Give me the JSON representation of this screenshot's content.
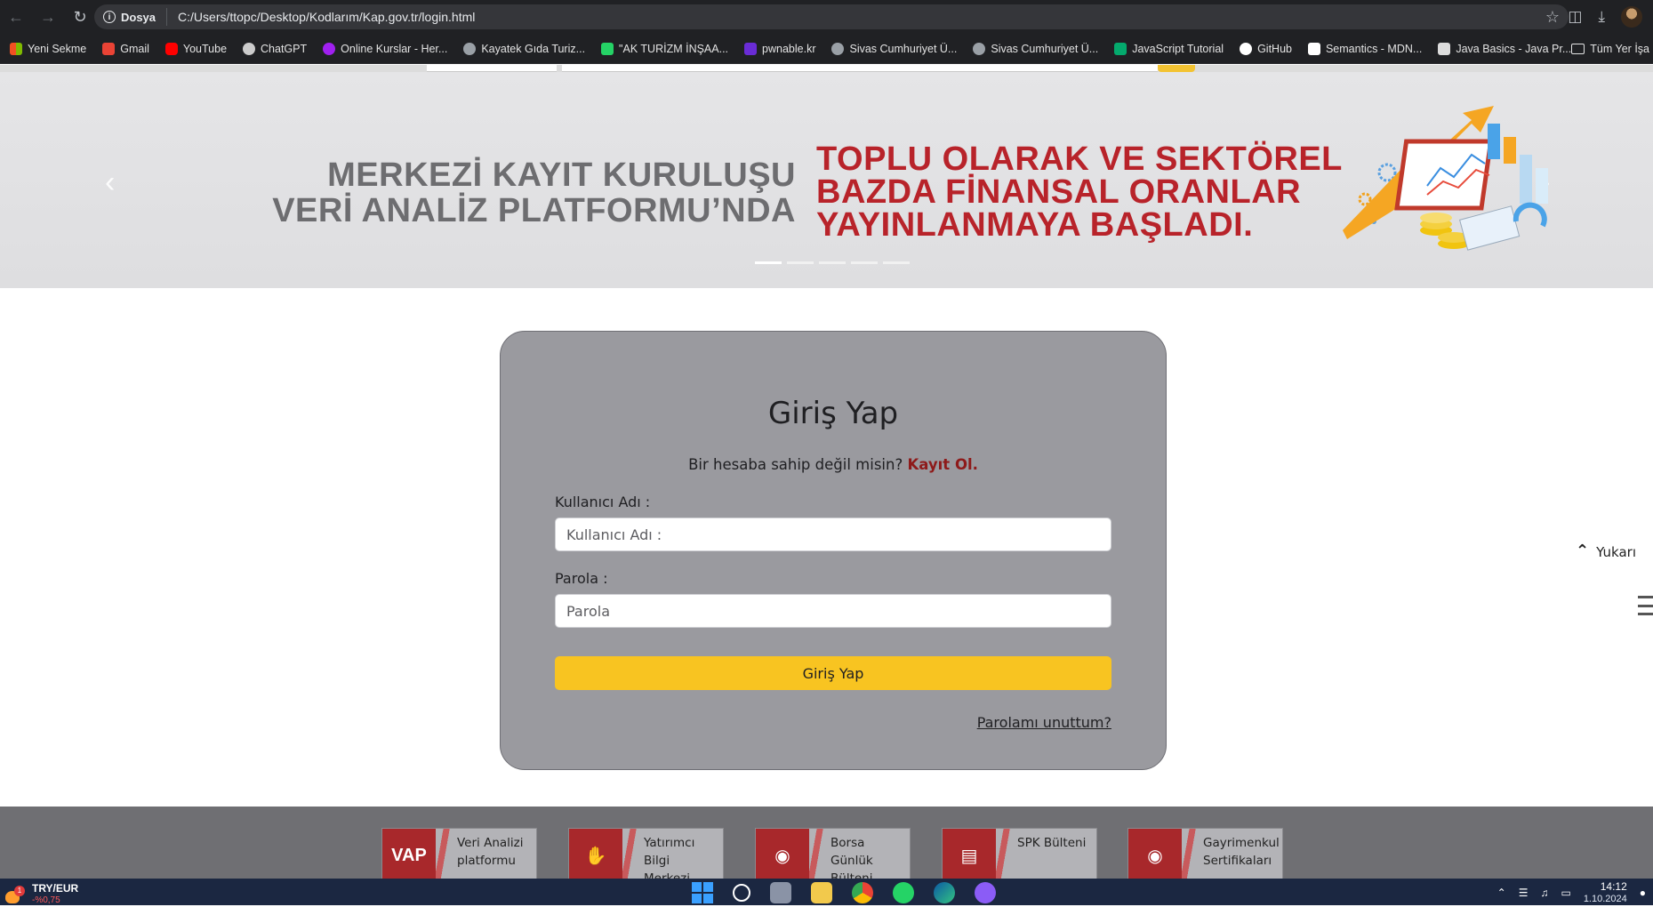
{
  "browser": {
    "chip_label": "Dosya",
    "url": "C:/Users/ttopc/Desktop/Kodlarım/Kap.gov.tr/login.html"
  },
  "bookmarks": [
    {
      "label": "Yeni Sekme",
      "icon": "windows-icon",
      "color": "#4285f4"
    },
    {
      "label": "Gmail",
      "icon": "gmail-icon",
      "color": "#ea4335"
    },
    {
      "label": "YouTube",
      "icon": "youtube-icon",
      "color": "#ff0000"
    },
    {
      "label": "ChatGPT",
      "icon": "chatgpt-icon",
      "color": "#cccccc"
    },
    {
      "label": "Online Kurslar - Her...",
      "icon": "course-icon",
      "color": "#a020f0"
    },
    {
      "label": "Kayatek Gıda Turiz...",
      "icon": "globe-icon",
      "color": "#bbbbbb"
    },
    {
      "label": "\"AK TURİZM İNŞAA...",
      "icon": "whatsapp-icon",
      "color": "#25d366"
    },
    {
      "label": "pwnable.kr",
      "icon": "hash-icon",
      "color": "#6a2cd6"
    },
    {
      "label": "Sivas Cumhuriyet Ü...",
      "icon": "globe-icon",
      "color": "#bbbbbb"
    },
    {
      "label": "Sivas Cumhuriyet Ü...",
      "icon": "globe-icon",
      "color": "#bbbbbb"
    },
    {
      "label": "JavaScript Tutorial",
      "icon": "w3schools-icon",
      "color": "#04aa6d"
    },
    {
      "label": "GitHub",
      "icon": "github-icon",
      "color": "#ffffff"
    },
    {
      "label": "Semantics - MDN...",
      "icon": "mdn-icon",
      "color": "#ffffff"
    },
    {
      "label": "Java Basics - Java Pr...",
      "icon": "terminal-icon",
      "color": "#dddddd"
    }
  ],
  "bookmarks_folder": "Tüm Yer İşa",
  "carousel": {
    "left_line1": "MERKEZİ KAYIT KURULUŞU",
    "left_line2": "VERİ ANALİZ PLATFORMU’NDA",
    "right_line1": "TOPLU OLARAK VE SEKTÖREL",
    "right_line2": "BAZDA FİNANSAL ORANLAR",
    "right_line3": "YAYINLANMAYA BAŞLADI.",
    "slide_count": 5,
    "active_slide": 1
  },
  "login": {
    "title": "Giriş Yap",
    "no_account_text": "Bir hesaba sahip değil misin?",
    "signup_link": "Kayıt Ol.",
    "username_label": "Kullanıcı Adı :",
    "username_placeholder": "Kullanıcı Adı :",
    "password_label": "Parola :",
    "password_placeholder": "Parola",
    "submit_label": "Giriş Yap",
    "forgot_link": "Parolamı unuttum?"
  },
  "scroll_top_label": "Yukarı",
  "footer_tiles": [
    {
      "label": "Veri Analizi platformu",
      "icon": "vap-logo-icon"
    },
    {
      "label": "Yatırımcı Bilgi Merkezi",
      "icon": "investor-hand-icon"
    },
    {
      "label": "Borsa Günlük Bülteni",
      "icon": "globe-icon"
    },
    {
      "label": "SPK Bülteni",
      "icon": "document-icon"
    },
    {
      "label": "Gayrimenkul Sertifikaları",
      "icon": "globe-icon"
    }
  ],
  "taskbar": {
    "widget_label": "TRY/EUR",
    "widget_sub": "-%0,75",
    "notification_count": "1",
    "time": "14:12",
    "date": "1.10.2024"
  },
  "colors": {
    "accent_yellow": "#f8c421",
    "brand_red": "#b8232a",
    "card_gray": "#9a9a9f",
    "signup_red": "#8e1a1a"
  }
}
